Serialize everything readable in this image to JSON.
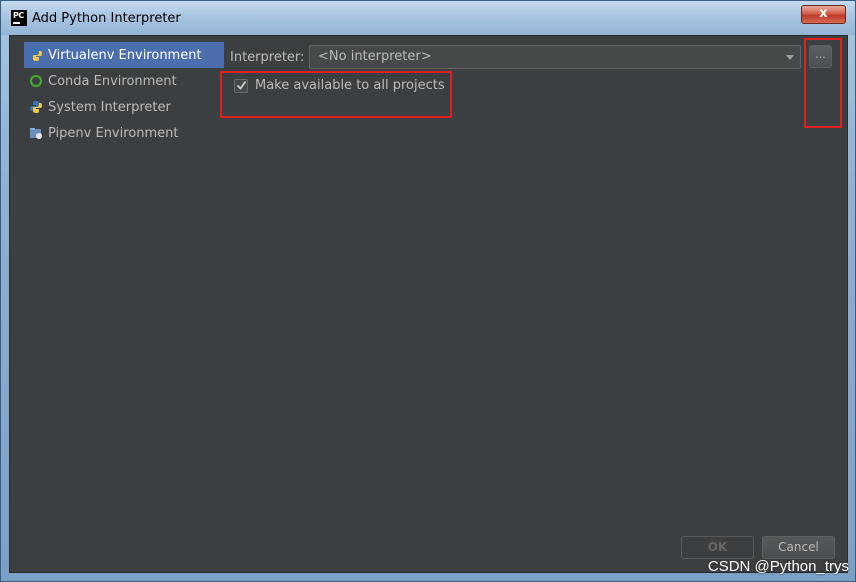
{
  "window": {
    "title": "Add Python Interpreter",
    "app_icon_text": "PC",
    "close_label": "x"
  },
  "sidebar": {
    "items": [
      {
        "label": "Virtualenv Environment",
        "icon": "python-venv-icon",
        "selected": true
      },
      {
        "label": "Conda Environment",
        "icon": "conda-ring-icon",
        "selected": false
      },
      {
        "label": "System Interpreter",
        "icon": "python-logo-icon",
        "selected": false
      },
      {
        "label": "Pipenv Environment",
        "icon": "pipenv-folder-icon",
        "selected": false
      }
    ]
  },
  "form": {
    "interpreter_label": "Interpreter:",
    "interpreter_value": "<No interpreter>",
    "browse_label": "...",
    "make_available_label": "Make available to all projects",
    "make_available_checked": true
  },
  "buttons": {
    "ok_label": "OK",
    "cancel_label": "Cancel"
  },
  "watermark": "CSDN @Python_trys",
  "colors": {
    "background": "#3c3f41",
    "selection": "#4b6eaf",
    "text": "#bbbbbb",
    "annotation_red": "#e02020"
  }
}
